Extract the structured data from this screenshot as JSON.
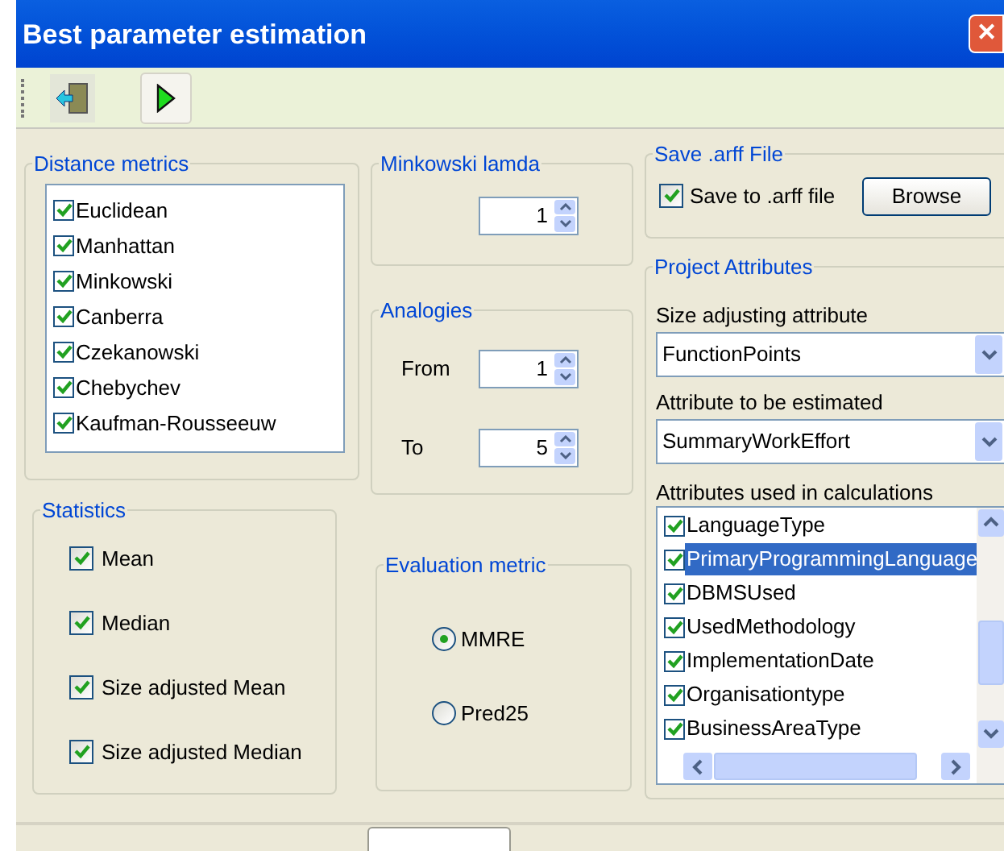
{
  "window": {
    "title": "Best parameter estimation",
    "close": "✕"
  },
  "toolbar": {
    "buttons": [
      {
        "kind": "exit"
      },
      {
        "kind": "run"
      }
    ]
  },
  "distance_metrics": {
    "title": "Distance metrics",
    "items": [
      {
        "label": "Euclidean",
        "checked": true
      },
      {
        "label": "Manhattan",
        "checked": true
      },
      {
        "label": "Minkowski",
        "checked": true
      },
      {
        "label": "Canberra",
        "checked": true
      },
      {
        "label": "Czekanowski",
        "checked": true
      },
      {
        "label": "Chebychev",
        "checked": true
      },
      {
        "label": "Kaufman-Rousseeuw",
        "checked": true
      }
    ]
  },
  "minkowski_lamda": {
    "title": "Minkowski lamda",
    "value": "1"
  },
  "analogies": {
    "title": "Analogies",
    "fields": [
      {
        "label": "From",
        "value": "1"
      },
      {
        "label": "To",
        "value": "5"
      }
    ]
  },
  "statistics": {
    "title": "Statistics",
    "items": [
      {
        "label": "Mean",
        "checked": true
      },
      {
        "label": "Median",
        "checked": true
      },
      {
        "label": "Size adjusted Mean",
        "checked": true
      },
      {
        "label": "Size adjusted Median",
        "checked": true
      }
    ]
  },
  "evaluation_metric": {
    "title": "Evaluation metric",
    "options": [
      {
        "label": "MMRE",
        "selected": true
      },
      {
        "label": "Pred25",
        "selected": false
      }
    ]
  },
  "save_arff": {
    "title": "Save .arff File",
    "checkbox": {
      "label": "Save to .arff file",
      "checked": true
    },
    "button": "Browse"
  },
  "project_attributes": {
    "title": "Project Attributes",
    "dropdowns": [
      {
        "label": "Size adjusting attribute",
        "value": "FunctionPoints"
      },
      {
        "label": "Attribute to be estimated",
        "value": "SummaryWorkEffort"
      }
    ],
    "list_label": "Attributes used in calculations",
    "items": [
      {
        "label": "LanguageType",
        "checked": true,
        "selected": false
      },
      {
        "label": "PrimaryProgrammingLanguage",
        "checked": true,
        "selected": true
      },
      {
        "label": "DBMSUsed",
        "checked": true,
        "selected": false
      },
      {
        "label": "UsedMethodology",
        "checked": true,
        "selected": false
      },
      {
        "label": "ImplementationDate",
        "checked": true,
        "selected": false
      },
      {
        "label": "Organisationtype",
        "checked": true,
        "selected": false
      },
      {
        "label": "BusinessAreaType",
        "checked": true,
        "selected": false
      }
    ]
  }
}
